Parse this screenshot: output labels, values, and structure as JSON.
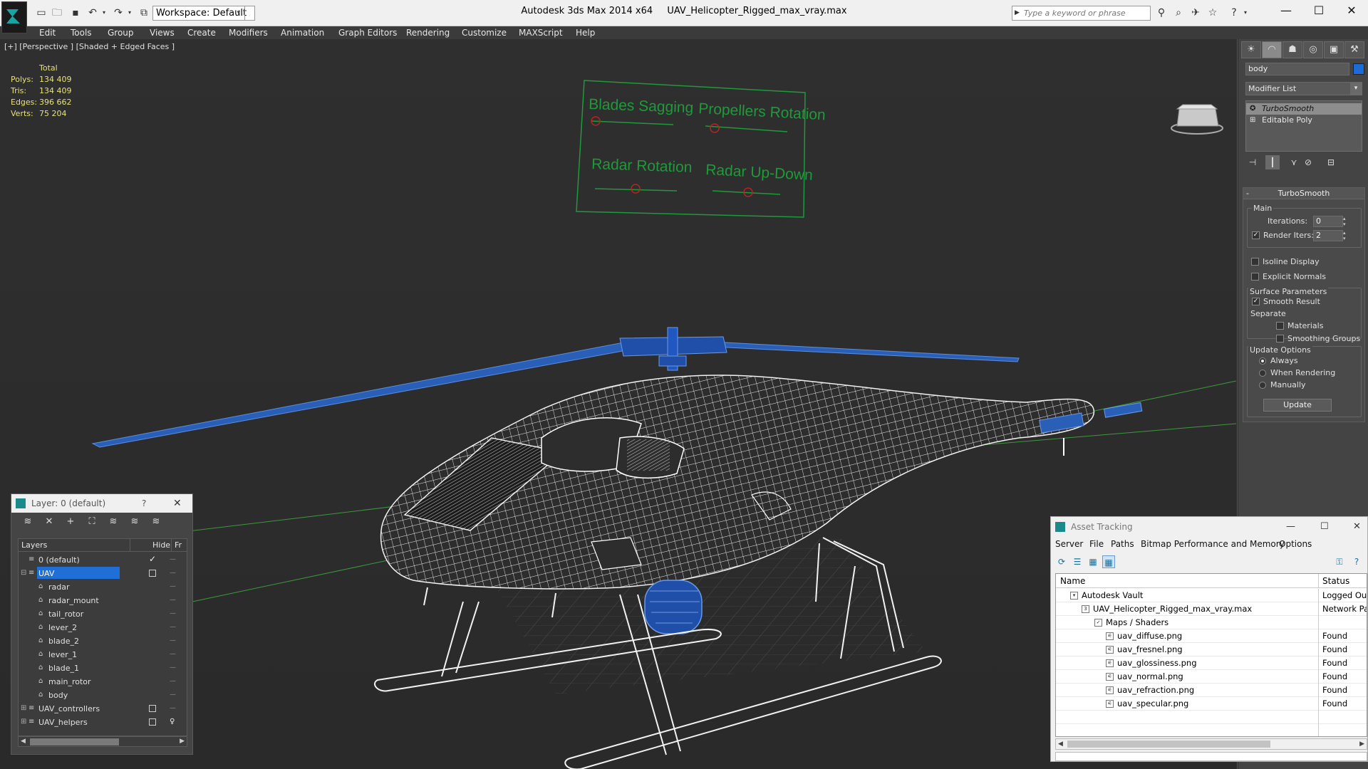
{
  "window": {
    "app_title": "Autodesk 3ds Max  2014 x64",
    "file_name": "UAV_Helicopter_Rigged_max_vray.max",
    "workspace_label": "Workspace: Default",
    "search_placeholder": "Type a keyword or phrase"
  },
  "menu": [
    "Edit",
    "Tools",
    "Group",
    "Views",
    "Create",
    "Modifiers",
    "Animation",
    "Graph Editors",
    "Rendering",
    "Customize",
    "MAXScript",
    "Help"
  ],
  "viewport": {
    "label": "[+] [Perspective ] [Shaded + Edged Faces ]",
    "stats": {
      "header": "Total",
      "rows": [
        {
          "k": "Polys:",
          "v": "134 409"
        },
        {
          "k": "Tris:",
          "v": "134 409"
        },
        {
          "k": "Edges:",
          "v": "396 662"
        },
        {
          "k": "Verts:",
          "v": "75 204"
        }
      ]
    },
    "control_panel": {
      "labels": [
        "Blades Sagging",
        "Propellers Rotation",
        "Radar Rotation",
        "Radar Up-Down"
      ]
    },
    "colors": {
      "wire": "#f2f2f2",
      "selected_wire": "#2a5fb8",
      "grid": "#3c9a3c",
      "controls": "#1f9a3a"
    }
  },
  "command_panel": {
    "object_name": "body",
    "object_color": "#1c6bd6",
    "modifier_list": "Modifier List",
    "stack": [
      "TurboSmooth",
      "Editable Poly"
    ],
    "rollout_title": "TurboSmooth",
    "main_group": "Main",
    "iterations_label": "Iterations:",
    "iterations_value": "0",
    "render_iters_label": "Render Iters:",
    "render_iters_value": "2",
    "isoline_label": "Isoline Display",
    "explicit_label": "Explicit Normals",
    "surface_group": "Surface Parameters",
    "smooth_label": "Smooth Result",
    "separate_label": "Separate",
    "materials_label": "Materials",
    "smoothing_groups_label": "Smoothing Groups",
    "update_group": "Update Options",
    "always_label": "Always",
    "when_rendering_label": "When Rendering",
    "manually_label": "Manually",
    "update_button": "Update"
  },
  "layer_window": {
    "title": "Layer: 0 (default)",
    "help": "?",
    "col_layers": "Layers",
    "col_hide": "Hide",
    "col_freeze": "Fr",
    "rows": [
      {
        "name": "0 (default)",
        "level": 0,
        "checked": true
      },
      {
        "name": "UAV",
        "level": 0,
        "selected": true
      },
      {
        "name": "radar",
        "level": 1
      },
      {
        "name": "radar_mount",
        "level": 1
      },
      {
        "name": "tail_rotor",
        "level": 1
      },
      {
        "name": "lever_2",
        "level": 1
      },
      {
        "name": "blade_2",
        "level": 1
      },
      {
        "name": "lever_1",
        "level": 1
      },
      {
        "name": "blade_1",
        "level": 1
      },
      {
        "name": "main_rotor",
        "level": 1
      },
      {
        "name": "body",
        "level": 1
      },
      {
        "name": "UAV_controllers",
        "level": 0,
        "expandable": true
      },
      {
        "name": "UAV_helpers",
        "level": 0,
        "expandable": true
      }
    ]
  },
  "asset_window": {
    "title": "Asset Tracking",
    "menu": [
      "Server",
      "File",
      "Paths",
      "Bitmap Performance and Memory",
      "Options"
    ],
    "col_name": "Name",
    "col_status": "Status",
    "rows": [
      {
        "name": "Autodesk Vault",
        "status": "Logged Out",
        "level": 0
      },
      {
        "name": "UAV_Helicopter_Rigged_max_vray.max",
        "status": "Network Path",
        "level": 1
      },
      {
        "name": "Maps / Shaders",
        "status": "",
        "level": 2
      },
      {
        "name": "uav_diffuse.png",
        "status": "Found",
        "level": 3
      },
      {
        "name": "uav_fresnel.png",
        "status": "Found",
        "level": 3
      },
      {
        "name": "uav_glossiness.png",
        "status": "Found",
        "level": 3
      },
      {
        "name": "uav_normal.png",
        "status": "Found",
        "level": 3
      },
      {
        "name": "uav_refraction.png",
        "status": "Found",
        "level": 3
      },
      {
        "name": "uav_specular.png",
        "status": "Found",
        "level": 3
      }
    ]
  }
}
